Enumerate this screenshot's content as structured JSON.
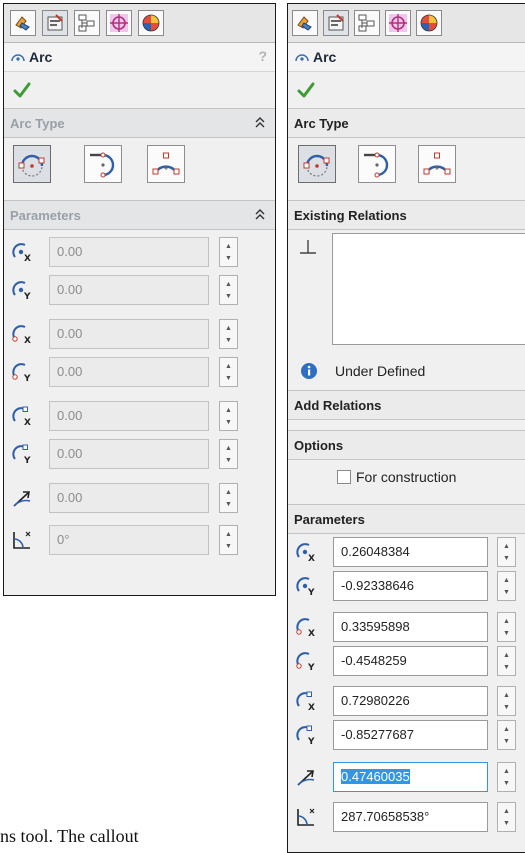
{
  "left_panel": {
    "title": "Arc",
    "help": "?",
    "groups": {
      "arc_type": "Arc Type",
      "parameters": "Parameters"
    },
    "arc_type_buttons": [
      "centerpoint-arc-icon",
      "tangent-arc-icon",
      "three-point-arc-icon"
    ],
    "params": [
      {
        "icon": "center-x-icon",
        "value": "0.00"
      },
      {
        "icon": "center-y-icon",
        "value": "0.00"
      },
      {
        "icon": "start-x-icon",
        "value": "0.00"
      },
      {
        "icon": "start-y-icon",
        "value": "0.00"
      },
      {
        "icon": "end-x-icon",
        "value": "0.00"
      },
      {
        "icon": "end-y-icon",
        "value": "0.00"
      },
      {
        "icon": "radius-icon",
        "value": "0.00"
      },
      {
        "icon": "angle-icon",
        "value": "0°"
      }
    ]
  },
  "right_panel": {
    "title": "Arc",
    "help": "?",
    "groups": {
      "arc_type": "Arc Type",
      "existing_relations": "Existing Relations",
      "add_relations": "Add Relations",
      "options": "Options",
      "parameters": "Parameters"
    },
    "status": "Under Defined",
    "options": {
      "for_construction": "For construction"
    },
    "params": [
      {
        "icon": "center-x-icon",
        "value": "0.26048384"
      },
      {
        "icon": "center-y-icon",
        "value": "-0.92338646"
      },
      {
        "icon": "start-x-icon",
        "value": "0.33595898"
      },
      {
        "icon": "start-y-icon",
        "value": "-0.4548259"
      },
      {
        "icon": "end-x-icon",
        "value": "0.72980226"
      },
      {
        "icon": "end-y-icon",
        "value": "-0.85277687"
      },
      {
        "icon": "radius-icon",
        "value": "0.47460035"
      },
      {
        "icon": "angle-icon",
        "value": "287.70658538°"
      }
    ]
  },
  "caption": "ns tool. The callout"
}
